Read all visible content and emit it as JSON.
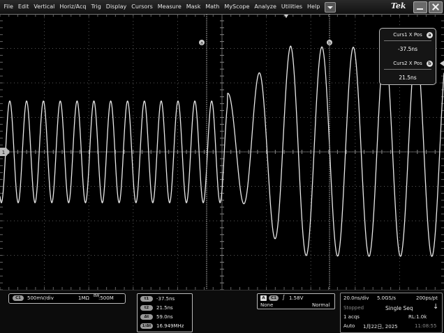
{
  "menubar": {
    "items": [
      "File",
      "Edit",
      "Vertical",
      "Horiz/Acq",
      "Trig",
      "Display",
      "Cursors",
      "Measure",
      "Mask",
      "Math",
      "MyScope",
      "Analyze",
      "Utilities",
      "Help"
    ],
    "logo": "Tek"
  },
  "cursor_panel": {
    "curs1_label": "Curs1 X Pos",
    "curs1_value": "-37.5ns",
    "curs1_badge": "a",
    "curs2_label": "Curs2 X Pos",
    "curs2_value": "21.5ns",
    "curs2_badge": "b"
  },
  "graticule": {
    "ch1_marker": "1",
    "cursor_a_label": "a",
    "cursor_b_label": "b"
  },
  "channel": {
    "badge": "C1",
    "scale": "500mV/div",
    "impedance": "1MΩ",
    "bw_symbol": "BW",
    "bandwidth": ":500M"
  },
  "cursor_readout": {
    "a_badge": "t1",
    "a_value": "-37.5ns",
    "b_badge": "t2",
    "b_value": "21.5ns",
    "delta_badge": "Δt",
    "delta_value": "59.0ns",
    "freq_badge": "1/Δt",
    "freq_value": "16.949MHz"
  },
  "trigger": {
    "a_badge": "A",
    "source_badge": "C1",
    "slope_symbol": "∫",
    "level": "1.58V",
    "coupling": "None",
    "mode": "Normal"
  },
  "acquisition": {
    "timebase": "20.0ns/div",
    "sample_rate": "5.0GS/s",
    "resolution": "200ps/pt",
    "state": "Stopped",
    "run_mode": "Single Seq",
    "acqs": "1 acqs",
    "record_length": "RL:1.0k",
    "horizontal_mode": "Auto",
    "date": "1月22日, 2025",
    "time": "11:08:55"
  },
  "colors": {
    "trace": "#e8e8e8",
    "grid": "#5a5a5a",
    "background": "#000000"
  }
}
